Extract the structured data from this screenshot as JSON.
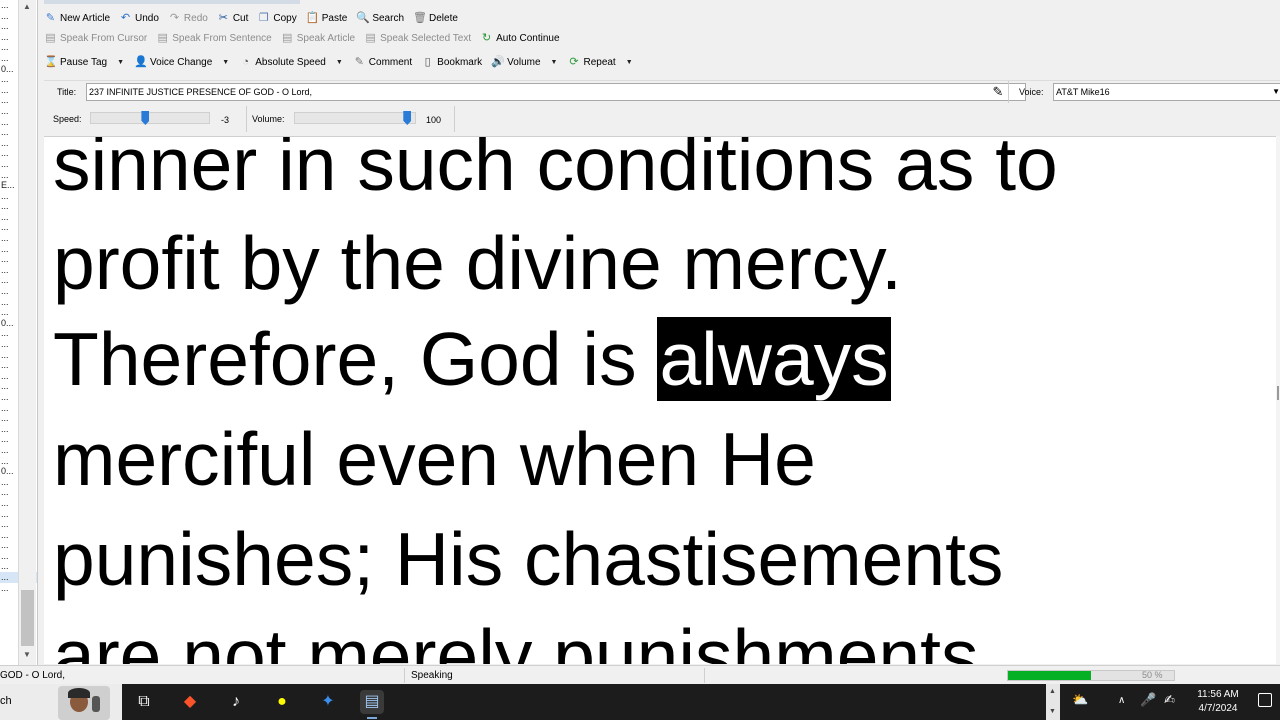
{
  "sidebar": {
    "rows": [
      "...",
      "...",
      "...",
      "...",
      "...",
      "...",
      "0...",
      "...",
      "...",
      "...",
      "...",
      "...",
      "...",
      "...",
      "...",
      "...",
      "...",
      "E...",
      "...",
      "...",
      "...",
      "...",
      "...",
      "...",
      "...",
      "...",
      "...",
      "...",
      "...",
      "...",
      "0...",
      "...",
      "...",
      "...",
      "...",
      "...",
      "...",
      "...",
      "...",
      "...",
      "...",
      "...",
      "...",
      "...",
      "0...",
      "...",
      "...",
      "...",
      "...",
      "...",
      "...",
      "...",
      "...",
      "...",
      "...",
      "..."
    ]
  },
  "toolbar1": {
    "new_article": "New Article",
    "undo": "Undo",
    "redo": "Redo",
    "cut": "Cut",
    "copy": "Copy",
    "paste": "Paste",
    "search": "Search",
    "delete": "Delete"
  },
  "toolbar2": {
    "speak_from_cursor": "Speak From Cursor",
    "speak_from_sentence": "Speak From Sentence",
    "speak_article": "Speak Article",
    "speak_selected_text": "Speak Selected Text",
    "auto_continue": "Auto Continue"
  },
  "toolbar3": {
    "pause_tag": "Pause Tag",
    "voice_change": "Voice Change",
    "absolute_speed": "Absolute Speed",
    "comment": "Comment",
    "bookmark": "Bookmark",
    "volume": "Volume",
    "repeat": "Repeat"
  },
  "title_row": {
    "label": "Title:",
    "value": "237 INFINITE JUSTICE PRESENCE OF GOD - O Lord,",
    "voice_label": "Voice:",
    "voice_value": "AT&T Mike16"
  },
  "speed_row": {
    "speed_label": "Speed:",
    "speed_value": "-3",
    "speed_fraction": 0.45,
    "volume_label": "Volume:",
    "volume_value": "100",
    "volume_fraction": 0.95
  },
  "reader": {
    "line1": "sinner in such conditions as to",
    "line2": "profit by the divine mercy.",
    "line3_before": "Therefore, God is ",
    "line3_highlight": "always",
    "line4": "merciful even when He",
    "line5": "punishes; His chastisements",
    "line6": "are not merely punishments"
  },
  "status": {
    "left": "GOD - O Lord,",
    "state": "Speaking",
    "progress_percent": 50,
    "progress_label": "50 %"
  },
  "taskbar": {
    "search_fragment": "ch",
    "time": "11:56 AM",
    "date": "4/7/2024"
  }
}
